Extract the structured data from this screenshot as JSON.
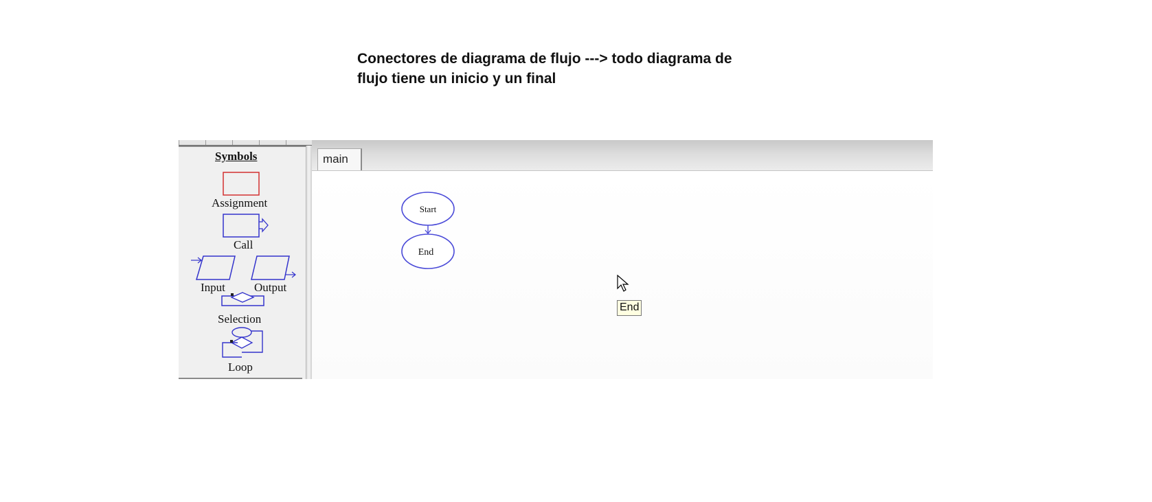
{
  "caption": {
    "line1": "Conectores de diagrama de flujo ---> todo diagrama de",
    "line2": "flujo tiene un inicio y un final"
  },
  "palette": {
    "title": "Symbols",
    "symbols": {
      "assignment": "Assignment",
      "call": "Call",
      "input": "Input",
      "output": "Output",
      "selection": "Selection",
      "loop": "Loop"
    },
    "colors": {
      "assignment_border": "#d23030",
      "symbol_stroke": "#3333cc"
    }
  },
  "tabs": [
    {
      "label": "main",
      "active": true
    }
  ],
  "flowchart": {
    "start_label": "Start",
    "end_label": "End",
    "node_stroke": "#4a4ad8"
  },
  "tooltip": {
    "text": "End"
  }
}
